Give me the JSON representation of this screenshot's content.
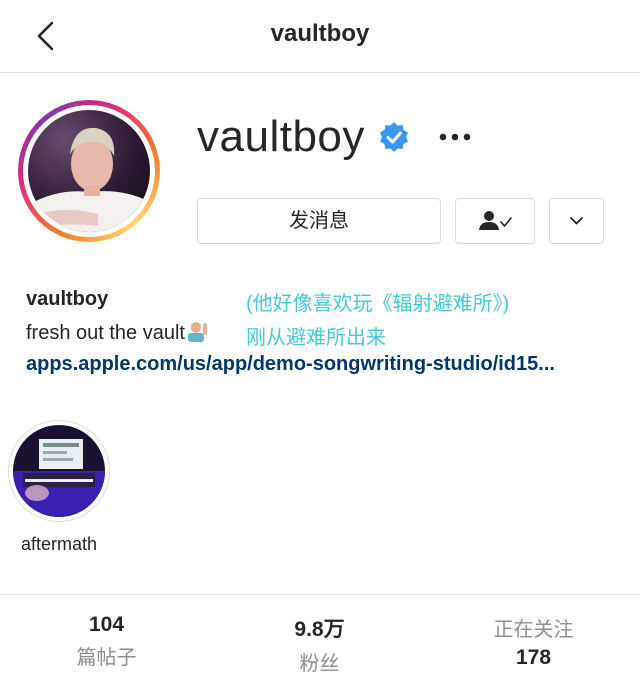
{
  "header": {
    "title": "vaultboy"
  },
  "profile": {
    "username": "vaultboy",
    "message_button": "发消息",
    "bio_name": "vaultboy",
    "bio_text": "fresh out the vault",
    "bio_link": "apps.apple.com/us/app/demo-songwriting-studio/id15..."
  },
  "annotations": {
    "line1": "(他好像喜欢玩《辐射避难所》)",
    "line2": "刚从避难所出来"
  },
  "highlights": [
    {
      "label": "aftermath"
    }
  ],
  "stats": {
    "posts": {
      "value": "104",
      "label": "篇帖子"
    },
    "followers": {
      "value": "9.8万",
      "label": "粉丝"
    },
    "following": {
      "value": "178",
      "label": "正在关注"
    }
  },
  "colors": {
    "verified": "#3897f0",
    "link": "#00376b",
    "annotation": "#48c9d8",
    "divider": "#dbdbdb"
  },
  "icons": [
    "back-arrow-icon",
    "verified-badge-icon",
    "more-options-icon",
    "person-check-icon",
    "chevron-down-icon"
  ]
}
